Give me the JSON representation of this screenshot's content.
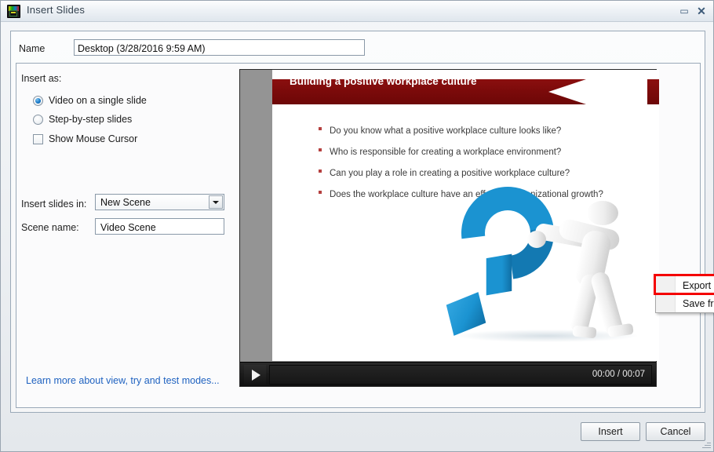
{
  "window": {
    "title": "Insert Slides",
    "icon": "app-icon",
    "restore_label": "▭",
    "close_label": "✕"
  },
  "name_field": {
    "label": "Name",
    "value": "Desktop (3/28/2016 9:59 AM)",
    "placeholder": "Name"
  },
  "options": {
    "insert_as_label": "Insert as:",
    "radios": [
      {
        "label": "Video on a single slide",
        "selected": true
      },
      {
        "label": "Step-by-step slides",
        "selected": false
      }
    ],
    "checkbox": {
      "label": "Show Mouse Cursor",
      "checked": false
    },
    "insert_slides_in_label": "Insert slides in:",
    "scene_select": {
      "value": "New Scene",
      "options": [
        "New Scene"
      ]
    },
    "scene_name_label": "Scene name:",
    "scene_name_value": "Video Scene",
    "learn_more_link": "Learn more about view, try and test modes..."
  },
  "slide": {
    "title": "Building a positive workplace culture",
    "bullets": [
      "Do you know what a positive workplace culture looks like?",
      "Who is responsible for creating a workplace environment?",
      "Can you play a role in creating a positive workplace culture?",
      "Does the workplace culture have an effect on organizational growth?"
    ]
  },
  "context_menu": {
    "items": [
      {
        "label": "Export movie",
        "highlighted": true
      },
      {
        "label": "Save frame",
        "highlighted": false
      }
    ]
  },
  "player": {
    "play_label": "play-icon",
    "time": "00:00 / 00:07",
    "current_time": "00:00",
    "duration": "00:07"
  },
  "footer": {
    "insert_label": "Insert",
    "cancel_label": "Cancel"
  },
  "colors": {
    "ribbon_red": "#7a0a0a",
    "bullet_red": "#b5403f",
    "highlight_red": "#f40000",
    "link_blue": "#1f62c0",
    "accent_blue": "#1b93d1",
    "letterbox_gray": "#949494"
  }
}
